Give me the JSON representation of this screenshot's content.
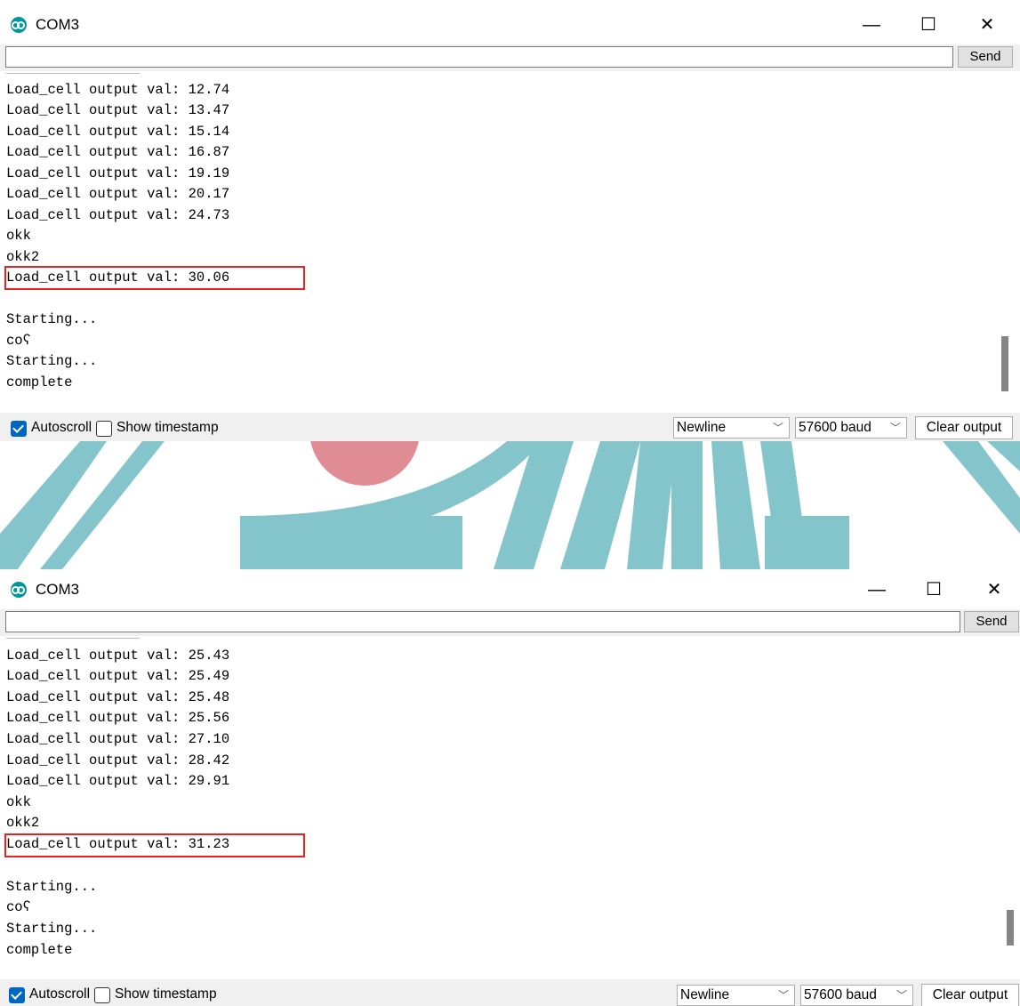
{
  "colors": {
    "backdrop_teal": "#84c5cb",
    "backdrop_pink": "#e08c94",
    "highlight": "#e8231f",
    "checkbox_accent": "#0067c0",
    "arduino_teal": "#00979c"
  },
  "windows": [
    {
      "title": "COM3",
      "icon": "arduino-icon",
      "minimize": "—",
      "maximize": "☐",
      "close": "✕",
      "send_label": "Send",
      "send_value": "",
      "lines": [
        "Load_cell output val: 12.74",
        "Load_cell output val: 13.47",
        "Load_cell output val: 15.14",
        "Load_cell output val: 16.87",
        "Load_cell output val: 19.19",
        "Load_cell output val: 20.17",
        "Load_cell output val: 24.73",
        "okk",
        "okk2",
        "Load_cell output val: 30.06",
        "",
        "Starting...",
        "coʕ",
        "Starting...",
        "complete"
      ],
      "highlighted_line": "Load_cell output val: 30.06",
      "autoscroll_label": "Autoscroll",
      "autoscroll_checked": true,
      "timestamp_label": "Show timestamp",
      "timestamp_checked": false,
      "line_ending": "Newline",
      "baud": "57600 baud",
      "clear_label": "Clear output"
    },
    {
      "title": "COM3",
      "icon": "arduino-icon",
      "minimize": "—",
      "maximize": "☐",
      "close": "✕",
      "send_label": "Send",
      "send_value": "",
      "lines": [
        "Load_cell output val: 25.43",
        "Load_cell output val: 25.49",
        "Load_cell output val: 25.48",
        "Load_cell output val: 25.56",
        "Load_cell output val: 27.10",
        "Load_cell output val: 28.42",
        "Load_cell output val: 29.91",
        "okk",
        "okk2",
        "Load_cell output val: 31.23",
        "",
        "Starting...",
        "coʕ",
        "Starting...",
        "complete"
      ],
      "highlighted_line": "Load_cell output val: 31.23",
      "autoscroll_label": "Autoscroll",
      "autoscroll_checked": true,
      "timestamp_label": "Show timestamp",
      "timestamp_checked": false,
      "line_ending": "Newline",
      "baud": "57600 baud",
      "clear_label": "Clear output"
    }
  ]
}
